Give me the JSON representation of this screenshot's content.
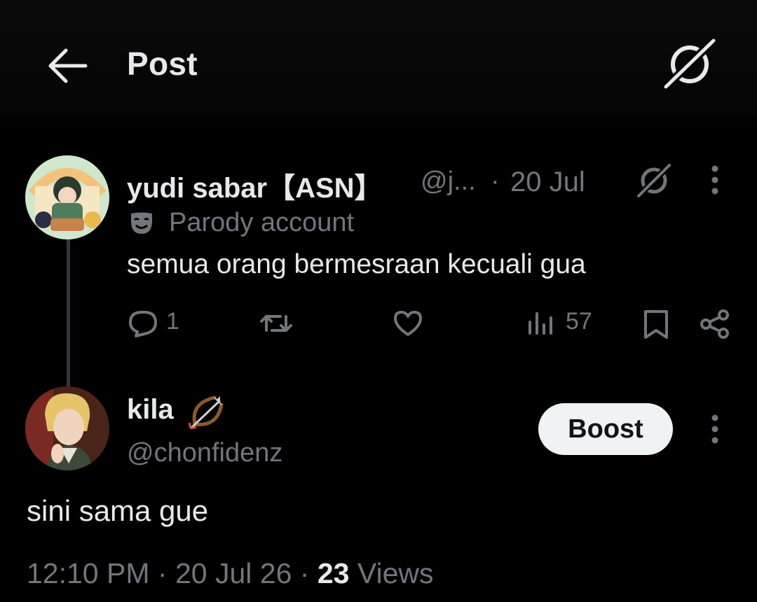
{
  "header": {
    "title": "Post"
  },
  "parent_post": {
    "display_name": "yudi sabar【ASN】",
    "handle": "@j...",
    "separator": "·",
    "time": "20 Jul",
    "account_label": "Parody account",
    "text": "semua orang bermesraan kecuali gua",
    "actions": {
      "replies": "1",
      "views": "57"
    }
  },
  "main_post": {
    "display_name": "kila",
    "name_emoji": "bow-and-arrow",
    "handle": "@chonfidenz",
    "boost_label": "Boost",
    "text": "sini sama gue",
    "meta": {
      "time": "12:10 PM",
      "date": "20 Jul 26",
      "views_count": "23",
      "views_label": "Views",
      "separator": "·"
    }
  },
  "icons": [
    "back-arrow-icon",
    "grok-icon",
    "more-icon",
    "parody-mask-icon",
    "reply-icon",
    "repost-icon",
    "like-icon",
    "views-icon",
    "bookmark-icon",
    "share-icon",
    "bow-and-arrow-icon"
  ],
  "colors": {
    "background": "#000000",
    "primary_text": "#e7e9ea",
    "secondary_text": "#71767b",
    "thread_line": "#333639",
    "boost_bg": "#eff3f4"
  }
}
